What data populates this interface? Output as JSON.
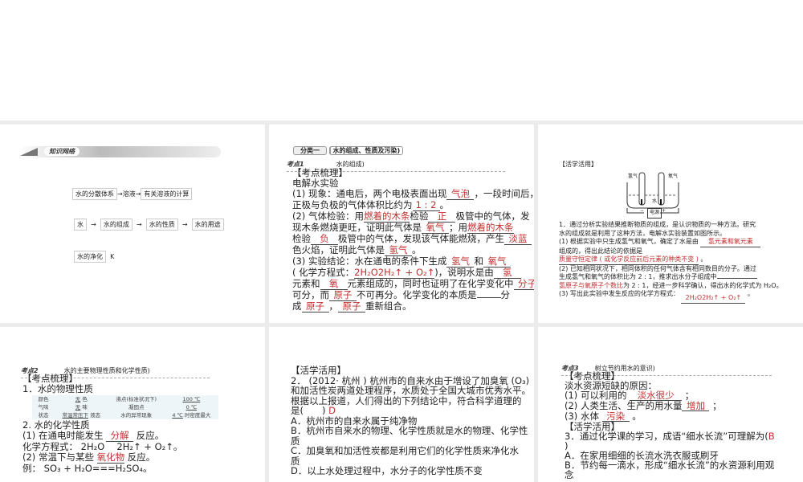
{
  "slide1": {
    "banner": "知识网络",
    "row1": [
      "水的分散体系",
      "溶液",
      "有关溶液的计算"
    ],
    "row2": [
      "水",
      "水的组成",
      "水的性质",
      "水的用途"
    ],
    "row3": "水的净化",
    "row3_tail": "K",
    "arrow": "→"
  },
  "slide2": {
    "category": "分类一",
    "category_title": "水的组成、性质及污染)",
    "kaodian": "考点1",
    "kaodian_title": "水的组成)",
    "heading": "【考点梳理】",
    "sub": "电解水实验",
    "l1a": "(1) 现象：通电后，两个电极表面出现",
    "a1": "气泡",
    "l1b": "，一段时间后，",
    "l2a": "正极与负极的气体体积比约为",
    "a2": "1 : 2",
    "l2b": "。",
    "l3a": "(2) 气体检验：用",
    "a3": "燃着的木条",
    "l3b": "检验",
    "a4": "正",
    "l3c": "极管中的气体，发",
    "l4a": "现木条燃烧更旺，证明此气体是",
    "a5": "氧气",
    "l4b": "；用",
    "a6": "燃着的木条",
    "l5a": "检验",
    "a7": "负",
    "l5b": "极管中的气体，发现该气体能燃烧，产生",
    "a8": "淡蓝",
    "l6a": "色火焰，证明此气体是",
    "a9": "氢气",
    "l6b": "。",
    "l7a": "(3) 实验结论：水在通电的条件下生成",
    "a10": "氢气",
    "l7b": "和",
    "a11": "氧气",
    "l8a": "( 化学方程式：",
    "a12": "2H₂O2H₂↑ + O₂↑",
    "l8b": ")，说明水是由",
    "a13": "氢",
    "l9a": "元素和",
    "a14": "氧",
    "l9b": "元素组成的，同时也证明了在化学变化中",
    "a15": "分子",
    "l10a": "可分，而",
    "a16": "原子",
    "l10b": "不可再分。化学变化的本质是",
    "l10c": "分",
    "l11a": "成",
    "a17": "原子",
    "l11b": "，",
    "a18": "原子",
    "l11c": "重新组合。"
  },
  "slide3": {
    "heading": "【活学活用】",
    "label_h2": "氢气",
    "label_o2": "氧气",
    "label_water": "水",
    "label_power": "电源",
    "minus": "−",
    "plus": "+",
    "q1a": "1．通过分析实验结果推断物质的组成，是认识物质的一种方法。研究",
    "q1b": "水的组成就是利用了这种方法，电解水实验装置如图所示。",
    "p1a": "(1) 根据实验中只生成氢气和氧气，确定了水是由",
    "a1": "氢元素和氧元素",
    "p1b": "组成的，得出此结论的依据是",
    "a2": "质量守恒定律 ( 或化学反应前后元素的种类不变 )",
    "p1c": "。",
    "p2a": "(2) 已知相同状况下，相同体积的任何气体含有相同数目的分子。通过",
    "p2b": "生成氢气和氧气的体积比为 2 : 1，推求出水分子组成中",
    "a3": "氢原子与氧原子个数比",
    "p2c": "为 2 : 1，经进一步科学确认，得出水的化学式为 H₂O。",
    "p3a": "(3) 写出此实验中发生反应的化学方程式：",
    "a4": "2H₂O2H₂↑ + O₂↑",
    "p3b": "。"
  },
  "slide4": {
    "kaodian": "考点2",
    "kaodian_title": "水的主要物理性质和化学性质)",
    "heading": "【考点梳理】",
    "sub1": "1．水的物理性质",
    "table": [
      [
        "颜色",
        "无",
        "色",
        "沸点(标准状况下)",
        "100 ℃",
        ""
      ],
      [
        "气味",
        "无",
        "味",
        "凝固点",
        "0 ℃",
        ""
      ],
      [
        "状态",
        "常温常压下",
        "液态",
        "水的异常现象",
        "4 ℃",
        "时密度最大"
      ]
    ],
    "sub2": "2. 水的化学性质",
    "l1a": "(1) 在通电时能发生",
    "a1": "分解",
    "l1b": "反应。",
    "l2": "化学方程式： 2H₂O　 2H₂↑ + O₂↑。",
    "l3a": "(2) 常温下与某些",
    "a2": "氧化物",
    "l3b": "反应。",
    "l4": "例： SO₃ + H₂O===H₂SO₄。"
  },
  "slide5": {
    "heading": "【活学活用】",
    "q": [
      "2． (2012· 杭州 ) 杭州市的自来水由于增设了加臭氧 (O₃)",
      "和加活性炭两道处理程序，水质处于全国大城市优秀水平。",
      "根据以上报道，人们得出的下列结论中，符合科学道理的",
      "是(　　)"
    ],
    "answer": "D",
    "opts": [
      "A．杭州市的自来水属于纯净物",
      "B．杭州市自来水的物理、化学性质就是水的物理、化学性",
      "质",
      "C．加臭氧和加活性炭都是利用它们的化学性质来净化水",
      "质",
      "D．以上水处理过程中，水分子的化学性质不变"
    ]
  },
  "slide6": {
    "kaodian": "考点3",
    "kaodian_title": "树立节约用水的意识)",
    "heading": "【考点梳理】",
    "sub": "淡水资源短缺的原因：",
    "l1a": "(1) 可以利用的",
    "a1": "淡水很少",
    "l1b": "；",
    "l2a": "(2) 人类生活、生产的用水量",
    "a2": "增加",
    "l2b": "；",
    "l3a": "(3) 水体",
    "a3": "污染",
    "l3b": "。",
    "heading2": "【活学活用】",
    "q": "3．通过化学课的学习，成语“细水长流”可理解为(",
    "answer": "B",
    "q2": ")",
    "optA": "A．在家用细细的长流水洗衣服或刷牙",
    "optB": "B．节约每一滴水，形成“细水长流”的水资源利用观",
    "optB2": "念"
  }
}
